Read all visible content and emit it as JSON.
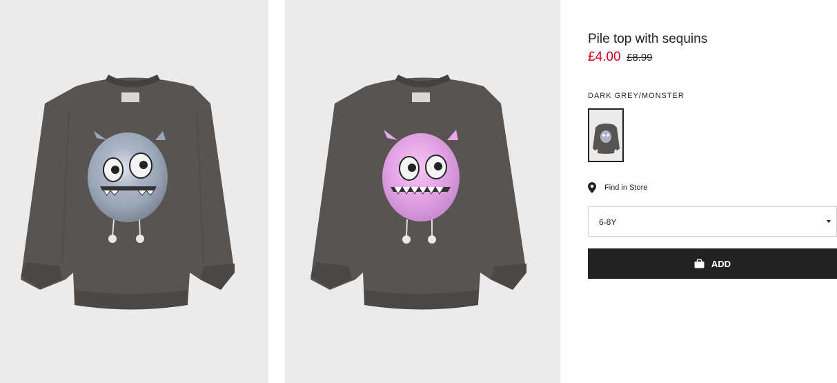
{
  "product": {
    "title": "Pile top with sequins",
    "price_sale": "£4.00",
    "price_original": "£8.99",
    "colour_name": "DARK GREY/MONSTER",
    "find_in_store": "Find in Store",
    "size_selected": "6-8Y",
    "add_label": "ADD"
  },
  "images": [
    {
      "name": "product-image-front",
      "monster_color": "silver"
    },
    {
      "name": "product-image-alt",
      "monster_color": "pink"
    }
  ],
  "icons": [
    "location-pin-icon",
    "chevron-down-icon",
    "shopping-bag-icon"
  ],
  "colors": {
    "sale_price": "#d6001c",
    "button_bg": "#222222",
    "garment": "#575452",
    "photo_bg": "#ebebeb"
  }
}
